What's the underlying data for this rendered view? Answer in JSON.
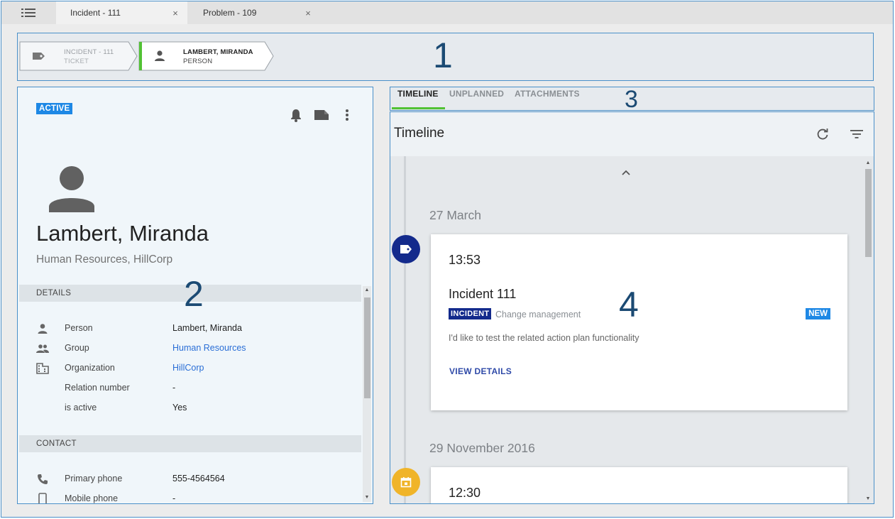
{
  "tabbar": {
    "menu_icon": "hamburger-menu-icon",
    "tabs": [
      {
        "label": "Incident - 111",
        "close": "×"
      },
      {
        "label": "Problem - 109",
        "close": "×"
      }
    ]
  },
  "breadcrumb": {
    "items": [
      {
        "title": "INCIDENT - 111",
        "subtitle": "TICKET",
        "icon": "ticket-icon"
      },
      {
        "title": "LAMBERT, MIRANDA",
        "subtitle": "PERSON",
        "icon": "person-icon"
      }
    ]
  },
  "annotations": {
    "a1": "1",
    "a2": "2",
    "a3": "3",
    "a4": "4"
  },
  "person_panel": {
    "status": "ACTIVE",
    "icons": [
      "bell-icon",
      "ticket-icon",
      "more-vertical-icon"
    ],
    "name": "Lambert, Miranda",
    "subtitle": "Human Resources, HillCorp",
    "details_header": "DETAILS",
    "details": [
      {
        "icon": "person-icon",
        "label": "Person",
        "value": "Lambert, Miranda"
      },
      {
        "icon": "group-icon",
        "label": "Group",
        "value": "Human Resources"
      },
      {
        "icon": "building-icon",
        "label": "Organization",
        "value": "HillCorp"
      },
      {
        "icon": "",
        "label": "Relation number",
        "value": "-"
      },
      {
        "icon": "",
        "label": "is active",
        "value": "Yes"
      }
    ],
    "contact_header": "CONTACT",
    "contact": [
      {
        "icon": "phone-icon",
        "label": "Primary phone",
        "value": "555-4564564"
      },
      {
        "icon": "mobile-icon",
        "label": "Mobile phone",
        "value": "-"
      }
    ]
  },
  "right_tabs": {
    "items": [
      "TIMELINE",
      "UNPLANNED",
      "ATTACHMENTS"
    ],
    "active": "TIMELINE"
  },
  "timeline": {
    "title": "Timeline",
    "icons": [
      "refresh-icon",
      "filter-icon"
    ],
    "groups": [
      {
        "date": "27 March",
        "card": {
          "time": "13:53",
          "title": "Incident 111",
          "tag": "INCIDENT",
          "category": "Change management",
          "badge": "NEW",
          "description": "I'd like to test the related action plan functionality",
          "action": "VIEW DETAILS"
        }
      },
      {
        "date": "29 November 2016",
        "card": {
          "time": "12:30"
        }
      }
    ]
  },
  "colors": {
    "accent_blue": "#1e88e5",
    "tag_navy": "#132a8c",
    "tab_indicator_green": "#52c234",
    "calendar_dot_yellow": "#f0b429",
    "border_blue": "#4a90c9"
  }
}
